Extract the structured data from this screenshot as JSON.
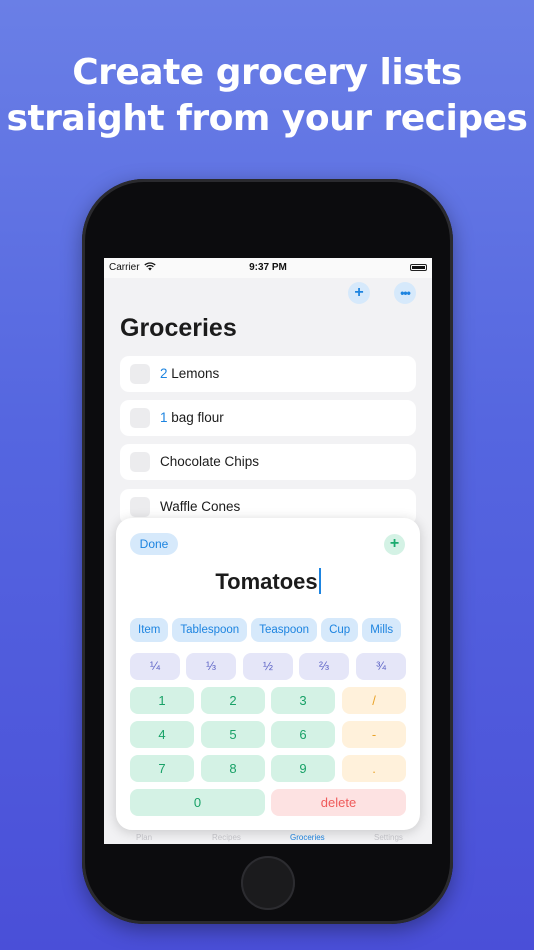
{
  "headline": {
    "line1": "Create grocery lists",
    "line2": "straight from your recipes"
  },
  "status_bar": {
    "carrier": "Carrier",
    "time": "9:37 PM"
  },
  "nav": {
    "add_icon": "plus-icon",
    "more_icon": "ellipsis-icon",
    "title": "Groceries"
  },
  "items": [
    {
      "qty": "2",
      "name": " Lemons"
    },
    {
      "qty": "1",
      "name": " bag flour"
    },
    {
      "qty": "",
      "name": "Chocolate Chips"
    },
    {
      "qty": "",
      "name": "Waffle Cones"
    }
  ],
  "editor": {
    "done_label": "Done",
    "add_icon": "plus-icon",
    "entry_text": "Tomatoes",
    "units": [
      "Item",
      "Tablespoon",
      "Teaspoon",
      "Cup",
      "Mills"
    ],
    "fractions": [
      "¼",
      "⅓",
      "½",
      "⅔",
      "¾"
    ],
    "digits": [
      "1",
      "2",
      "3",
      "4",
      "5",
      "6",
      "7",
      "8",
      "9",
      "0"
    ],
    "symbols": [
      "/",
      "-",
      "."
    ],
    "delete_label": "delete"
  },
  "tabs": [
    {
      "label": "Plan",
      "active": false
    },
    {
      "label": "Recipes",
      "active": false
    },
    {
      "label": "Groceries",
      "active": true
    },
    {
      "label": "Settings",
      "active": false
    }
  ],
  "colors": {
    "accent_blue": "#1d84e0",
    "green": "#18a167",
    "orange": "#e9a32a",
    "red": "#ef5a5a",
    "purple": "#5c63c6"
  }
}
